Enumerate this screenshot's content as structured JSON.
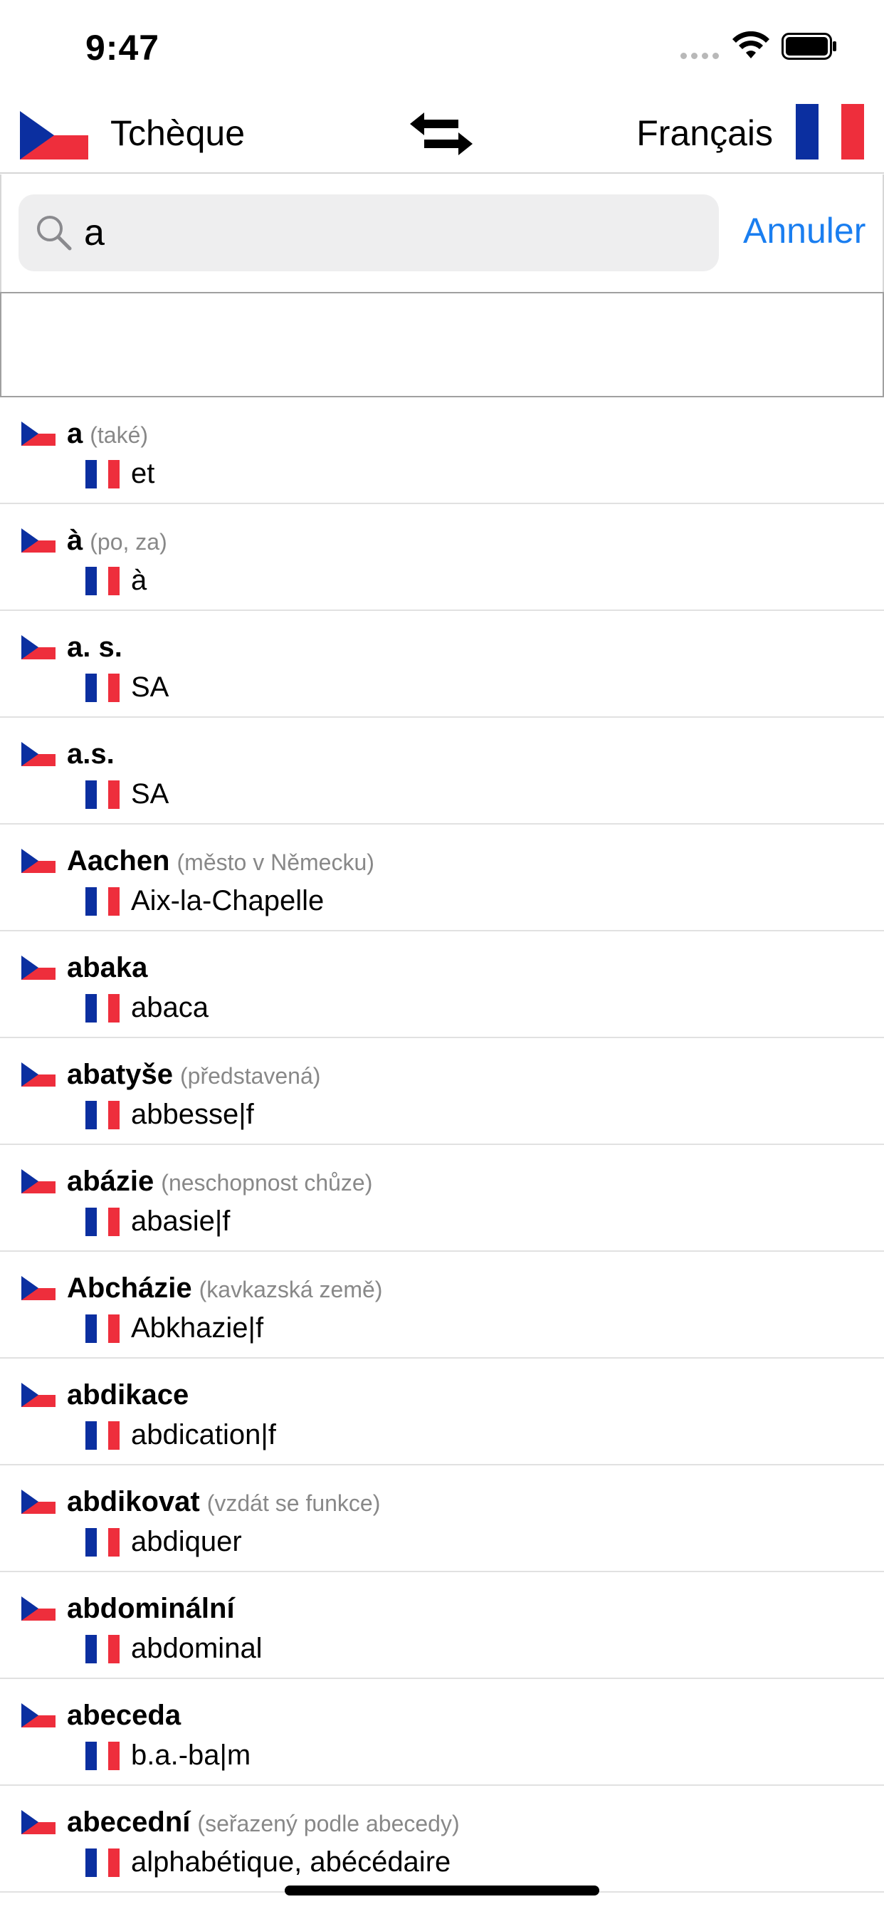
{
  "status_bar": {
    "time": "9:47"
  },
  "languages": {
    "source": "Tchèque",
    "target": "Français"
  },
  "search": {
    "value": "a",
    "cancel_label": "Annuler"
  },
  "results": [
    {
      "word": "a",
      "note": "(také)",
      "translation": "et"
    },
    {
      "word": "à",
      "note": "(po, za)",
      "translation": "à"
    },
    {
      "word": "a. s.",
      "note": "",
      "translation": "SA"
    },
    {
      "word": "a.s.",
      "note": "",
      "translation": "SA"
    },
    {
      "word": "Aachen",
      "note": "(město v Německu)",
      "translation": "Aix-la-Chapelle"
    },
    {
      "word": "abaka",
      "note": "",
      "translation": "abaca"
    },
    {
      "word": "abatyše",
      "note": "(představená)",
      "translation": "abbesse|f"
    },
    {
      "word": "abázie",
      "note": "(neschopnost chůze)",
      "translation": "abasie|f"
    },
    {
      "word": "Abcházie",
      "note": "(kavkazská země)",
      "translation": "Abkhazie|f"
    },
    {
      "word": "abdikace",
      "note": "",
      "translation": "abdication|f"
    },
    {
      "word": "abdikovat",
      "note": "(vzdát se funkce)",
      "translation": "abdiquer"
    },
    {
      "word": "abdominální",
      "note": "",
      "translation": "abdominal"
    },
    {
      "word": "abeceda",
      "note": "",
      "translation": "b.a.-ba|m"
    },
    {
      "word": "abecední",
      "note": "(seřazený podle abecedy)",
      "translation": "alphabétique, abécédaire"
    }
  ],
  "colors": {
    "accent": "#1a7ef0",
    "flag_blue": "#0b2fa0",
    "flag_red": "#ee2e3c"
  }
}
